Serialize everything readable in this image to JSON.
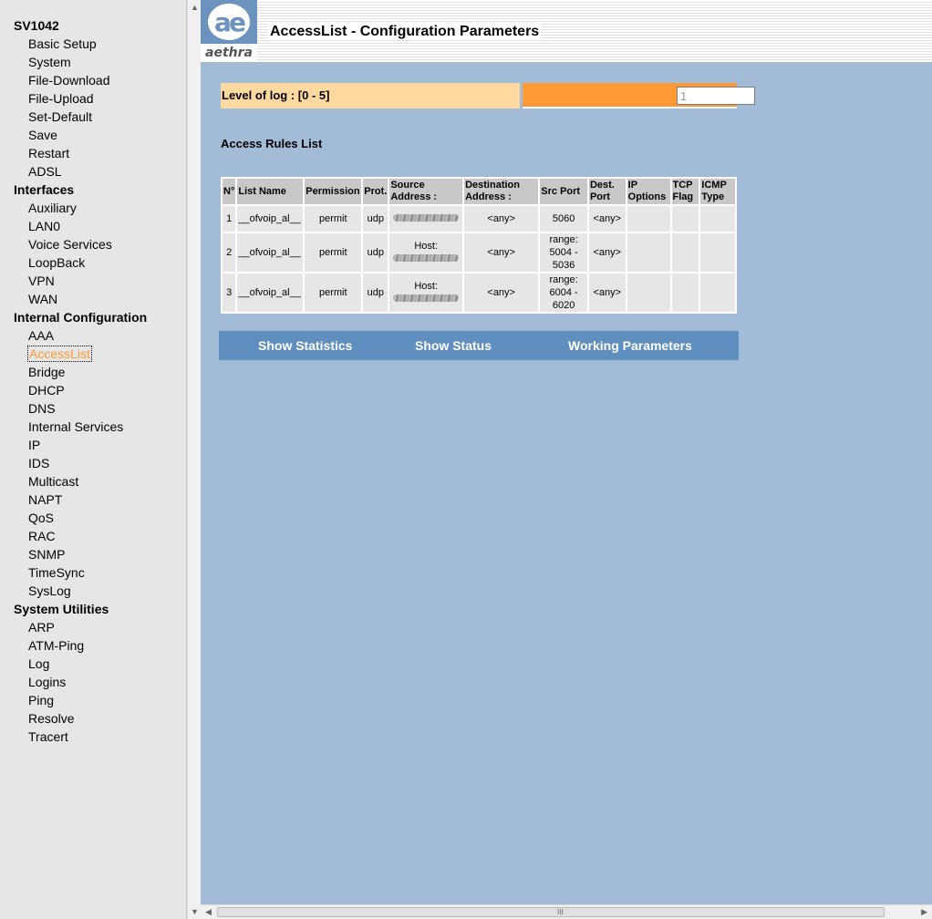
{
  "nav": {
    "groups": [
      {
        "title": "SV1042",
        "items": [
          "Basic Setup",
          "System",
          "File-Download",
          "File-Upload",
          "Set-Default",
          "Save",
          "Restart",
          "ADSL"
        ]
      },
      {
        "title": "Interfaces",
        "items": [
          "Auxiliary",
          "LAN0",
          "Voice Services",
          "LoopBack",
          "VPN",
          "WAN"
        ]
      },
      {
        "title": "Internal Configuration",
        "items": [
          "AAA",
          "AccessList",
          "Bridge",
          "DHCP",
          "DNS",
          "Internal Services",
          "IP",
          "IDS",
          "Multicast",
          "NAPT",
          "QoS",
          "RAC",
          "SNMP",
          "TimeSync",
          "SysLog"
        ]
      },
      {
        "title": "System Utilities",
        "items": [
          "ARP",
          "ATM-Ping",
          "Log",
          "Logins",
          "Ping",
          "Resolve",
          "Tracert"
        ]
      }
    ],
    "active_item": "AccessList",
    "active_color": "#ff9933"
  },
  "header": {
    "logo_mark": "ae",
    "logo_word": "aethra",
    "title": "AccessList - Configuration Parameters"
  },
  "log": {
    "label": "Level of log : [0 - 5]",
    "value": "1"
  },
  "rules": {
    "title": "Access Rules List",
    "columns": [
      "N°",
      "List Name",
      "Permission",
      "Prot.",
      "Source Address :",
      "Destination Address :",
      "Src Port",
      "Dest. Port",
      "IP Options",
      "TCP Flag",
      "ICMP Type"
    ],
    "rows": [
      {
        "n": "1",
        "list_name": "__ofvoip_al__",
        "permission": "permit",
        "prot": "udp",
        "source": "",
        "destination": "<any>",
        "src_port": "5060",
        "dest_port": "<any>",
        "ip_options": "",
        "tcp_flag": "",
        "icmp_type": ""
      },
      {
        "n": "2",
        "list_name": "__ofvoip_al__",
        "permission": "permit",
        "prot": "udp",
        "source": "Host:",
        "destination": "<any>",
        "src_port": "range: 5004 - 5036",
        "dest_port": "<any>",
        "ip_options": "",
        "tcp_flag": "",
        "icmp_type": ""
      },
      {
        "n": "3",
        "list_name": "__ofvoip_al__",
        "permission": "permit",
        "prot": "udp",
        "source": "Host:",
        "destination": "<any>",
        "src_port": "range: 6004 - 6020",
        "dest_port": "<any>",
        "ip_options": "",
        "tcp_flag": "",
        "icmp_type": ""
      }
    ]
  },
  "actions": {
    "show_statistics": "Show Statistics",
    "show_status": "Show Status",
    "working_parameters": "Working Parameters"
  },
  "colors": {
    "main_bg": "#a2bcd8",
    "label_bg": "#ffd9a0",
    "accent_orange": "#ff9933",
    "bar_blue": "#5f8fbf"
  }
}
